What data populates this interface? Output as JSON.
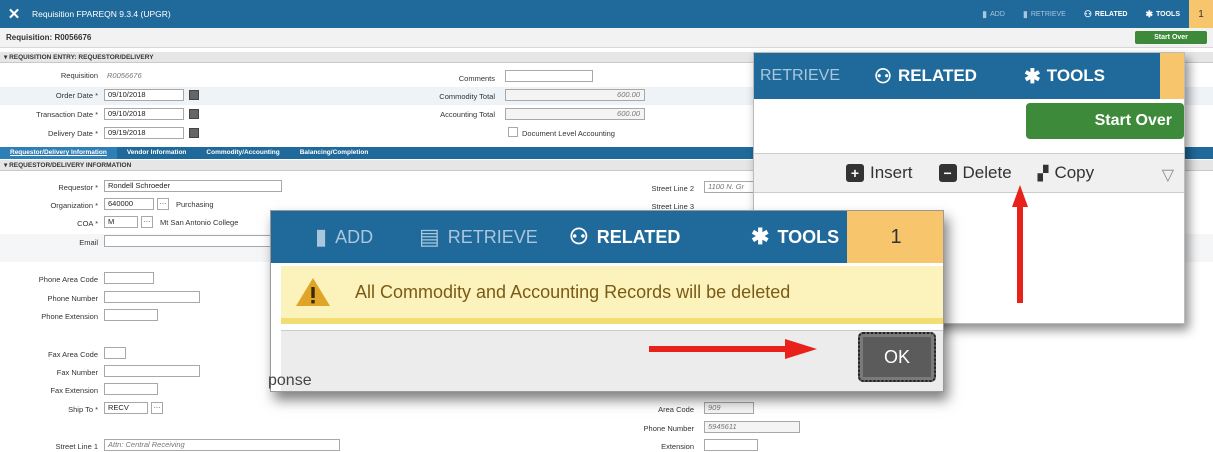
{
  "topbar": {
    "title": "Requisition FPAREQN 9.3.4 (UPGR)",
    "close_icon": "close-icon",
    "add": "ADD",
    "retrieve": "RETRIEVE",
    "related": "RELATED",
    "tools": "TOOLS",
    "badge": "1"
  },
  "req": {
    "heading": "Requisition: R0056676",
    "start_over": "Start Over"
  },
  "section1": {
    "title": "REQUISITION ENTRY: REQUESTOR/DELIVERY"
  },
  "entry": {
    "requisition_label": "Requisition",
    "requisition_value": "R0056676",
    "order_date_label": "Order Date *",
    "order_date": "09/10/2018",
    "transaction_date_label": "Transaction Date *",
    "transaction_date": "09/10/2018",
    "delivery_date_label": "Delivery Date *",
    "delivery_date": "09/19/2018",
    "comments_label": "Comments",
    "commodity_total_label": "Commodity Total",
    "commodity_total": "600.00",
    "accounting_total_label": "Accounting Total",
    "accounting_total": "600.00",
    "doc_level_label": "Document Level Accounting"
  },
  "tabs": [
    "Requestor/Delivery Information",
    "Vendor Information",
    "Commodity/Accounting",
    "Balancing/Completion"
  ],
  "section2": {
    "title": "REQUESTOR/DELIVERY INFORMATION"
  },
  "requestor": {
    "requestor_label": "Requestor *",
    "requestor": "Rondell Schroeder",
    "org_label": "Organization *",
    "org": "640000",
    "org_desc": "Purchasing",
    "coa_label": "COA *",
    "coa": "M",
    "coa_desc": "Mt San Antonio College",
    "email_label": "Email",
    "phone_area_label": "Phone Area Code",
    "phone_number_label": "Phone Number",
    "phone_ext_label": "Phone Extension",
    "fax_area_label": "Fax Area Code",
    "fax_number_label": "Fax Number",
    "fax_ext_label": "Fax Extension",
    "ship_to_label": "Ship To *",
    "ship_to": "RECV",
    "street1_label": "Street Line 1",
    "street1": "Attn: Central Receiving",
    "street2_label": "Street Line 2",
    "street2": "1100 N. Gr",
    "street3_label": "Street Line 3",
    "area_code_label": "Area Code",
    "area_code": "909",
    "phone_label": "Phone Number",
    "phone": "5945611",
    "extension_label": "Extension"
  },
  "zoom": {
    "retrieve": "RETRIEVE",
    "related": "RELATED",
    "tools": "TOOLS",
    "start_over": "Start Over",
    "insert": "Insert",
    "delete": "Delete",
    "copy": "Copy"
  },
  "dialog": {
    "add": "ADD",
    "retrieve": "RETRIEVE",
    "related": "RELATED",
    "tools": "TOOLS",
    "badge": "1",
    "message": "All Commodity and Accounting Records will be deleted",
    "ok": "OK",
    "bg_text": "ponse"
  },
  "colors": {
    "brand": "#1f6a9b",
    "accent": "#f7c56b",
    "success": "#3c8a3a",
    "warning_bg": "#fbf3bb",
    "arrow": "#e8211b"
  }
}
